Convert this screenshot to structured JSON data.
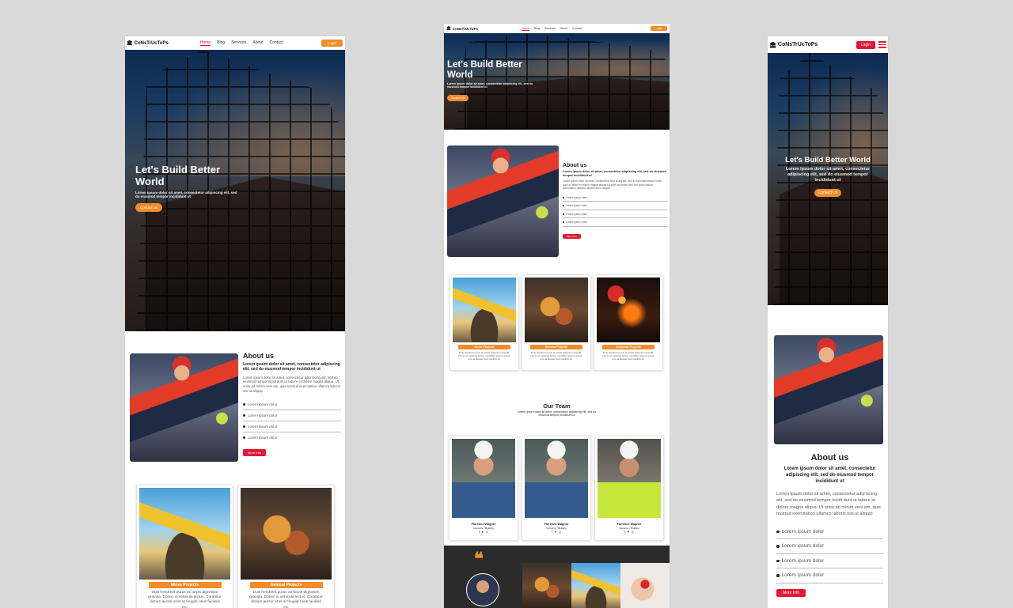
{
  "brand": "CoNsTrUcToPs",
  "nav": {
    "items": [
      "Home",
      "Blog",
      "Services",
      "About",
      "Contact"
    ],
    "login": "Login"
  },
  "hero": {
    "title": "Let's Build Better World",
    "subtitle": "Lorem ipsum dolor sit amet, consectetur adipiscing elit, sed do eiusmod tempor incididunt ut",
    "cta": "Contact Us"
  },
  "about": {
    "title": "About us",
    "lead": "Lorem ipsum dolor sit amet, consectetur adipiscing elit, sed do eiusmod tempor incididunt ut",
    "body": "Lorem ipsum dolor sit amet, consectetur adip iscing elit, sed do eiusmod tempor incidi dunt ut labore et dolore magna aliqua. Ut enim ad minim veni am, quis nostrud exercitation ullamco laboris nisi ut aliquip",
    "list": [
      "Lorem ipsum dolor",
      "Lorem ipsum dolor",
      "Lorem ipsum dolor",
      "Lorem ipsum dolor"
    ],
    "more": "More Info"
  },
  "projects": [
    {
      "label": "Mines Projects",
      "text": "Duis hendrerit purus ac turpis dignissim gravida. Donec in vehicula lectus. Curabitur dictum auctor eros at feugiat risus facilisis eu."
    },
    {
      "label": "General Projects",
      "text": "Duis hendrerit purus ac turpis dignissim gravida. Donec in vehicula lectus. Curabitur dictum auctor eros at feugiat risus facilisis eu."
    },
    {
      "label": "Industrial Projects",
      "text": "Duis hendrerit purus ac turpis dignissim gravida. Donec in vehicula lectus. Curabitur dictum auctor eros at feugiat risus facilisis eu."
    }
  ],
  "team": {
    "title": "Our Team",
    "subtitle": "Lorem ipsum dolor sit amet, consectetur adipiscing elit, sed do eiusmod tempor incididunt ut",
    "members": [
      {
        "name": "Florence Wagner",
        "role": "Instructor / Building"
      },
      {
        "name": "Florence Wagner",
        "role": "Instructor / Building"
      },
      {
        "name": "Florence Wagner",
        "role": "Instructor / Building"
      }
    ],
    "social": [
      "f",
      "♥",
      "◎"
    ]
  },
  "quote_mark": "❝",
  "colors": {
    "accent_orange": "#f28c28",
    "accent_red": "#e31837",
    "dark_band": "#2b2b2b"
  },
  "icons": [
    "building-icon",
    "hamburger-menu-icon",
    "bullet-icon",
    "facebook-icon",
    "twitter-icon",
    "instagram-icon",
    "quote-icon"
  ]
}
